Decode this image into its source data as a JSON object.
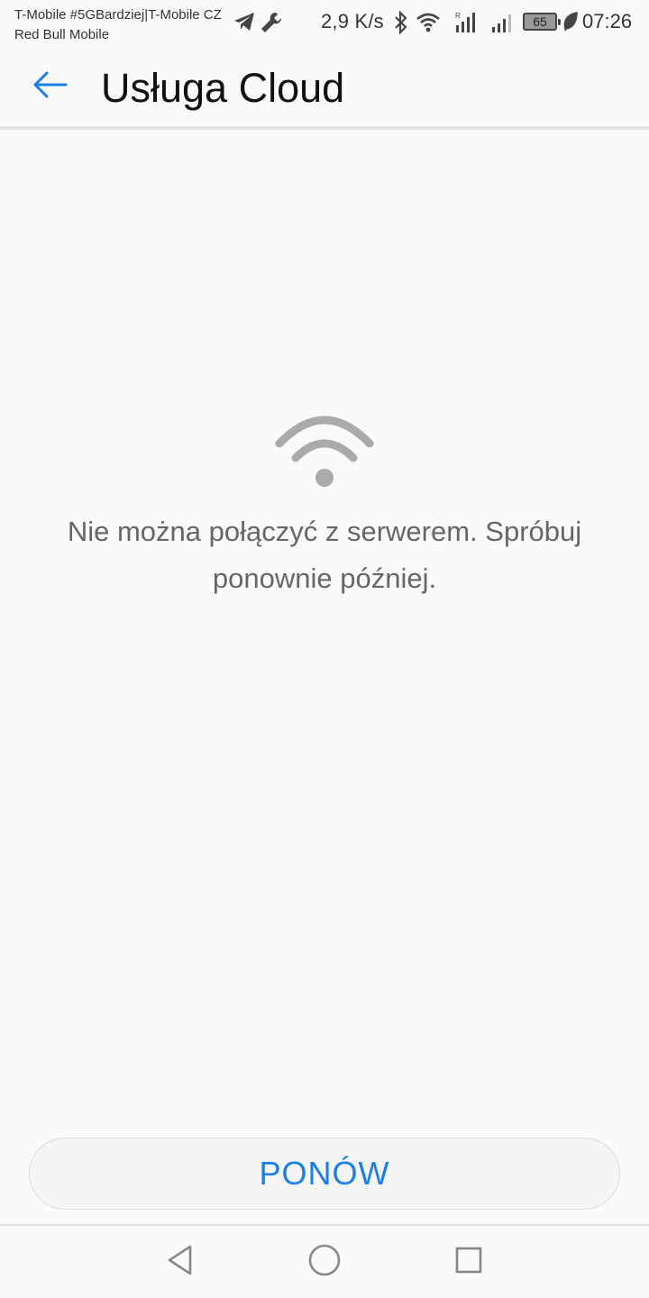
{
  "status_bar": {
    "carrier_line1": "T-Mobile #5GBardziej|T-Mobile CZ",
    "carrier_line2": "Red Bull Mobile",
    "network_speed": "2,9 K/s",
    "battery_level": "65",
    "time": "07:26",
    "icons": [
      "telegram-icon",
      "wrench-icon",
      "bluetooth-icon",
      "wifi-icon",
      "roaming-signal-icon",
      "signal-icon",
      "battery-icon",
      "leaf-icon"
    ]
  },
  "app_bar": {
    "title": "Usługa Cloud"
  },
  "error": {
    "icon": "wifi-icon",
    "message": "Nie można połączyć z serwerem. Spróbuj ponownie później."
  },
  "retry_button": {
    "label": "PONÓW"
  },
  "nav_bar": {
    "icons": [
      "back-triangle-icon",
      "home-circle-icon",
      "recents-square-icon"
    ]
  },
  "colors": {
    "accent": "#1a7fe6",
    "background": "#fafafa",
    "message_text": "#666666",
    "icon_gray": "#aaaaaa"
  }
}
